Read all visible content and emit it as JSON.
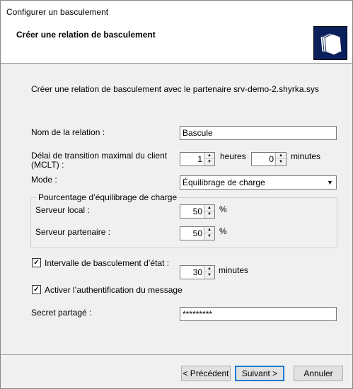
{
  "window": {
    "title": "Configurer un basculement"
  },
  "header": {
    "title": "Créer une relation de basculement",
    "icon": "folders-icon"
  },
  "intro_text": "Créer une relation de basculement avec le partenaire srv-demo-2.shyrka.sys",
  "relation_name": {
    "label": "Nom de la relation :",
    "value": "Bascule"
  },
  "mclt": {
    "label_line1": "Délai de transition maximal du client",
    "label_line2": "(MCLT) :",
    "hours_value": "1",
    "hours_label": "heures",
    "minutes_value": "0",
    "minutes_label": "minutes"
  },
  "mode": {
    "label": "Mode :",
    "value": "Équilibrage de charge"
  },
  "load_balance": {
    "title": "Pourcentage d’équilibrage de charge",
    "local_label": "Serveur local :",
    "local_value": "50",
    "partner_label": "Serveur partenaire :",
    "partner_value": "50",
    "unit": "%"
  },
  "state_switchover": {
    "label": "Intervalle de basculement d’état :",
    "checked": true,
    "value": "30",
    "unit": "minutes"
  },
  "auth": {
    "label": "Activer l’authentification du message",
    "checked": true
  },
  "shared_secret": {
    "label": "Secret partagé :",
    "value": "*********"
  },
  "buttons": {
    "back": "< Précédent",
    "next": "Suivant >",
    "cancel": "Annuler"
  }
}
